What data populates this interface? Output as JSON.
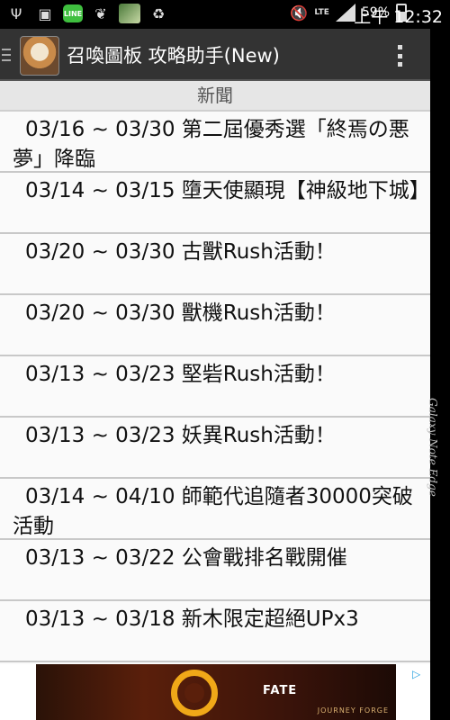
{
  "status_bar": {
    "battery_percent": "59%",
    "battery_level": 0.59,
    "network": "LTE",
    "time_ampm": "上午",
    "time": "12:32",
    "left_icons": [
      "usb-icon",
      "image-icon",
      "line-app-icon",
      "wings-icon",
      "game-app-icon",
      "recycle-icon"
    ],
    "right_icons": [
      "mute-icon",
      "signal-icon",
      "battery-icon"
    ]
  },
  "app_bar": {
    "title": "召喚圖板 攻略助手(New)"
  },
  "news": {
    "header": "新聞",
    "items": [
      "03/16 ~ 03/30 第二屆優秀選「終焉の悪夢」降臨",
      "03/14 ~ 03/15 墮天使顯現【神級地下城】",
      "03/20 ~ 03/30 古獸Rush活動！",
      "03/20 ~ 03/30 獸機Rush活動！",
      "03/13 ~ 03/23 堅砦Rush活動！",
      "03/13 ~ 03/23 妖異Rush活動！",
      "03/14 ~ 04/10 師範代追隨者30000突破活動",
      "03/13 ~ 03/22 公會戰排名戰開催",
      "03/13 ~ 03/18 新木限定超絕UPx3"
    ]
  },
  "edge_panel": {
    "label": "Galaxy Note Edge"
  },
  "ad": {
    "title": "FATE",
    "subtitle": "JOURNEY FORGE",
    "colors": {
      "logo": "#f0a818",
      "background": "#5a1f0b"
    }
  }
}
